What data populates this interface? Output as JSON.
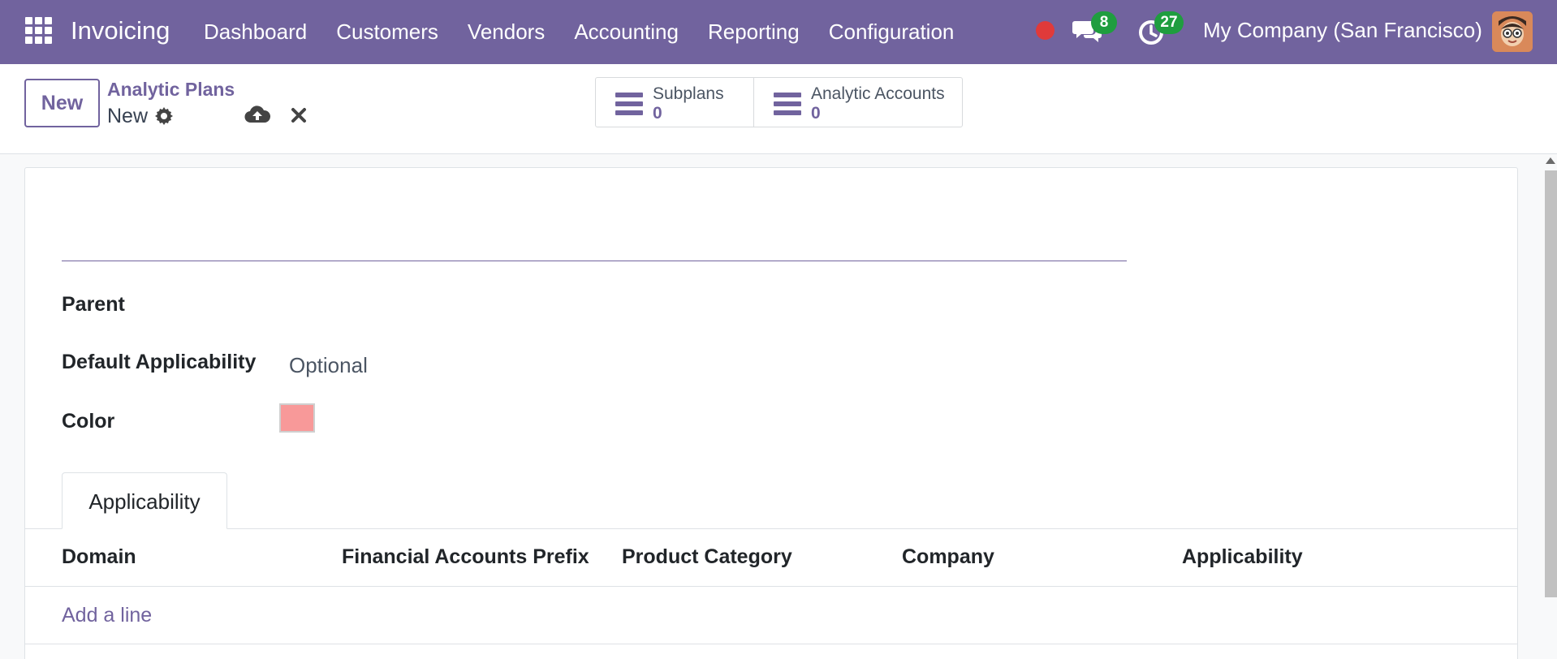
{
  "navbar": {
    "app_name": "Invoicing",
    "menu": [
      "Dashboard",
      "Customers",
      "Vendors",
      "Accounting",
      "Reporting",
      "Configuration"
    ],
    "messages_count": "8",
    "activities_count": "27",
    "company": "My Company (San Francisco)",
    "brand_color": "#71639e",
    "icons": [
      "apps-icon",
      "record-dot-icon",
      "chat-icon",
      "clock-icon",
      "avatar"
    ]
  },
  "control_panel": {
    "new_button": "New",
    "breadcrumb": "Analytic Plans",
    "record_name": "New",
    "icons": [
      "gear-icon",
      "cloud-upload-icon",
      "close-icon"
    ],
    "smart_buttons": [
      {
        "label": "Subplans",
        "count": "0",
        "icon": "list-icon"
      },
      {
        "label": "Analytic Accounts",
        "count": "0",
        "icon": "list-icon"
      }
    ]
  },
  "form": {
    "name_value": "",
    "fields": {
      "parent_label": "Parent",
      "parent_value": "",
      "applicability_label": "Default Applicability",
      "applicability_value": "Optional",
      "color_label": "Color",
      "color_value": "#f89999"
    },
    "tab": "Applicability",
    "columns": [
      "Domain",
      "Financial Accounts Prefix",
      "Product Category",
      "Company",
      "Applicability"
    ],
    "add_line": "Add a line"
  }
}
